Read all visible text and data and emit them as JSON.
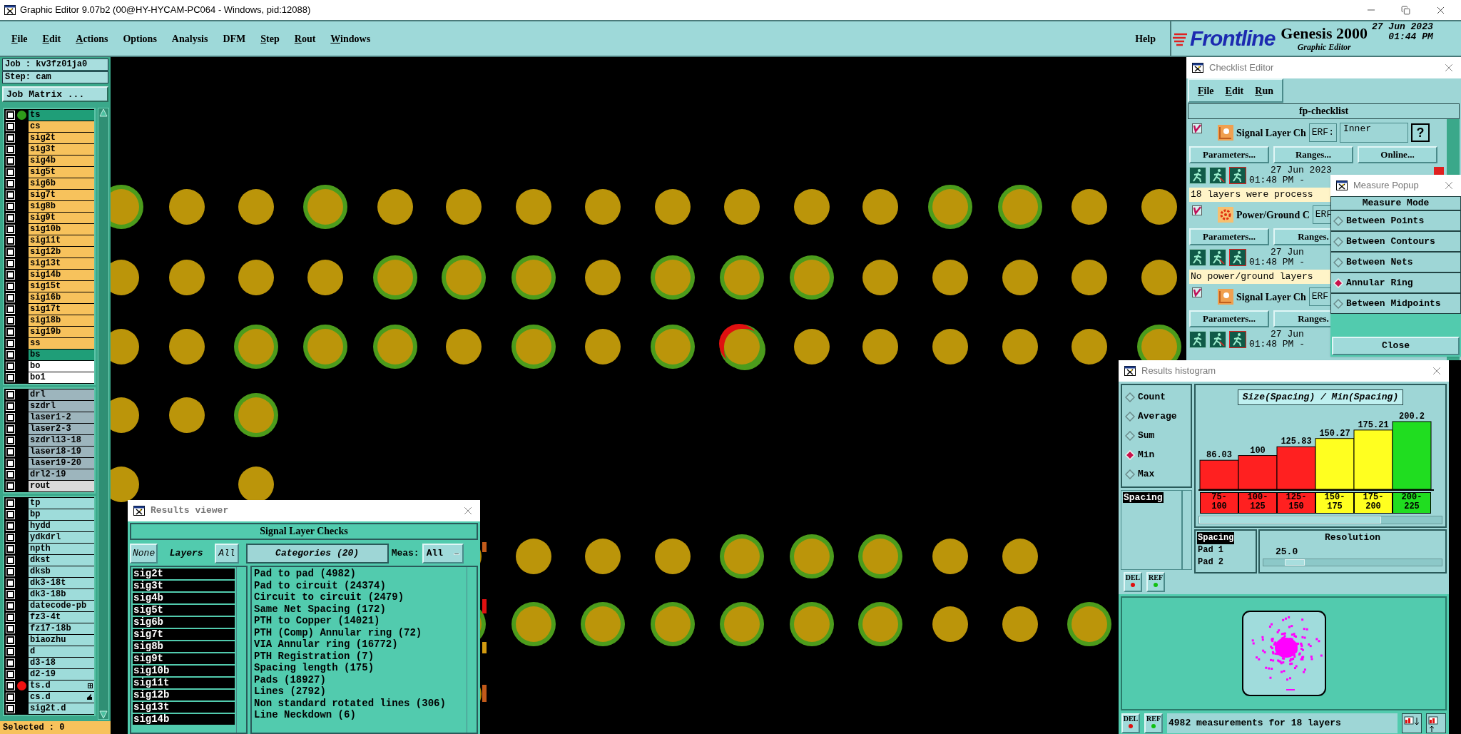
{
  "window": {
    "title": "Graphic Editor 9.07b2 (00@HY-HYCAM-PC064 - Windows, pid:12088)"
  },
  "menu": {
    "items": [
      {
        "label": "File",
        "underlined": true
      },
      {
        "label": "Edit",
        "underlined": true
      },
      {
        "label": "Actions",
        "underlined": true
      },
      {
        "label": "Options",
        "underlined": false
      },
      {
        "label": "Analysis",
        "underlined": false
      },
      {
        "label": "DFM",
        "underlined": false
      },
      {
        "label": "Step",
        "underlined": true
      },
      {
        "label": "Rout",
        "underlined": true
      },
      {
        "label": "Windows",
        "underlined": true
      }
    ],
    "help": "Help"
  },
  "logo": {
    "brand": "Frontline",
    "product": "Genesis 2000",
    "subtitle": "Graphic Editor",
    "date": "27 Jun 2023",
    "time": "01:44 PM"
  },
  "job_panel": {
    "job": "Job : kv3fz01ja0",
    "step": "Step: cam",
    "matrix_button": "Job Matrix ...",
    "selected_count": "Selected : 0",
    "groups": [
      {
        "layers": [
          {
            "name": "ts",
            "color": "#1f9e78",
            "checked": false,
            "dot": {
              "color": "#2e9a1a"
            }
          },
          {
            "name": "cs",
            "color": "#f7c25c",
            "checked": false
          },
          {
            "name": "sig2t",
            "color": "#f7c25c",
            "checked": false
          },
          {
            "name": "sig3t",
            "color": "#f7c25c",
            "checked": false
          },
          {
            "name": "sig4b",
            "color": "#f7c25c",
            "checked": false
          },
          {
            "name": "sig5t",
            "color": "#f7c25c",
            "checked": false
          },
          {
            "name": "sig6b",
            "color": "#f7c25c",
            "checked": false
          },
          {
            "name": "sig7t",
            "color": "#f7c25c",
            "checked": false
          },
          {
            "name": "sig8b",
            "color": "#f7c25c",
            "checked": false
          },
          {
            "name": "sig9t",
            "color": "#f7c25c",
            "checked": false
          },
          {
            "name": "sig10b",
            "color": "#f7c25c",
            "checked": false
          },
          {
            "name": "sig11t",
            "color": "#f7c25c",
            "checked": false
          },
          {
            "name": "sig12b",
            "color": "#f7c25c",
            "checked": false
          },
          {
            "name": "sig13t",
            "color": "#f7c25c",
            "checked": false
          },
          {
            "name": "sig14b",
            "color": "#f7c25c",
            "checked": false
          },
          {
            "name": "sig15t",
            "color": "#f7c25c",
            "checked": false
          },
          {
            "name": "sig16b",
            "color": "#f7c25c",
            "checked": false
          },
          {
            "name": "sig17t",
            "color": "#f7c25c",
            "checked": false
          },
          {
            "name": "sig18b",
            "color": "#f7c25c",
            "checked": false
          },
          {
            "name": "sig19b",
            "color": "#f7c25c",
            "checked": false
          },
          {
            "name": "ss",
            "color": "#f7c25c",
            "checked": false
          },
          {
            "name": "bs",
            "color": "#1f9e78",
            "checked": false
          },
          {
            "name": "bo",
            "color": "#ffffff",
            "checked": false
          },
          {
            "name": "bo1",
            "color": "#ffffff",
            "checked": false
          }
        ]
      },
      {
        "layers": [
          {
            "name": "drl",
            "color": "#9db5bd",
            "checked": false
          },
          {
            "name": "szdrl",
            "color": "#9db5bd",
            "checked": false
          },
          {
            "name": "laser1-2",
            "color": "#9db5bd",
            "checked": false
          },
          {
            "name": "laser2-3",
            "color": "#9db5bd",
            "checked": false
          },
          {
            "name": "szdrl13-18",
            "color": "#9db5bd",
            "checked": false
          },
          {
            "name": "laser18-19",
            "color": "#9db5bd",
            "checked": false
          },
          {
            "name": "laser19-20",
            "color": "#9db5bd",
            "checked": false
          },
          {
            "name": "drl2-19",
            "color": "#9db5bd",
            "checked": false
          },
          {
            "name": "rout",
            "color": "#d9d9d9",
            "checked": false
          }
        ]
      },
      {
        "layers": [
          {
            "name": "tp",
            "color": "#9edcda",
            "checked": false
          },
          {
            "name": "bp",
            "color": "#9edcda",
            "checked": false
          },
          {
            "name": "hydd",
            "color": "#9edcda",
            "checked": false
          },
          {
            "name": "ydkdrl",
            "color": "#9edcda",
            "checked": false
          },
          {
            "name": "npth",
            "color": "#9edcda",
            "checked": false
          },
          {
            "name": "dkst",
            "color": "#9edcda",
            "checked": false
          },
          {
            "name": "dksb",
            "color": "#9edcda",
            "checked": false
          },
          {
            "name": "dk3-18t",
            "color": "#9edcda",
            "checked": false
          },
          {
            "name": "dk3-18b",
            "color": "#9edcda",
            "checked": false
          },
          {
            "name": "datecode-pb",
            "color": "#9edcda",
            "checked": false
          },
          {
            "name": "fz3-4t",
            "color": "#9edcda",
            "checked": false
          },
          {
            "name": "fz17-18b",
            "color": "#9edcda",
            "checked": false
          },
          {
            "name": "biaozhu",
            "color": "#9edcda",
            "checked": false
          },
          {
            "name": "d",
            "color": "#9edcda",
            "checked": false
          },
          {
            "name": "d3-18",
            "color": "#9edcda",
            "checked": false
          },
          {
            "name": "d2-19",
            "color": "#9edcda",
            "checked": false
          },
          {
            "name": "ts.d",
            "color": "#9edcda",
            "checked": false,
            "dot": {
              "color": "#ee1111"
            },
            "kind": "grid"
          },
          {
            "name": "cs.d",
            "color": "#9edcda",
            "checked": false,
            "kind": "hand"
          },
          {
            "name": "sig2t.d",
            "color": "#9edcda",
            "checked": false
          }
        ]
      }
    ]
  },
  "checklist_editor": {
    "title": "Checklist Editor",
    "menu": [
      "File",
      "Edit",
      "Run"
    ],
    "name": "fp-checklist",
    "checks": [
      {
        "checked": true,
        "kind": "signal",
        "name": "Signal Layer Ch",
        "erf": "ERF:",
        "erf_value": "Inner",
        "help": "?",
        "buttons": [
          "Parameters...",
          "Ranges...",
          "Online..."
        ],
        "date": "27 Jun 2023",
        "time": "01:48 PM -",
        "message": "18 layers were process"
      },
      {
        "checked": true,
        "kind": "power",
        "name": "Power/Ground C",
        "erf": "ERF",
        "buttons": [
          "Parameters...",
          "Ranges."
        ],
        "date": "27 Jun",
        "time": "01:48 PM -",
        "message": "No power/ground layers"
      },
      {
        "checked": true,
        "kind": "signal",
        "name": "Signal Layer Ch",
        "erf": "ERF",
        "buttons": [
          "Parameters...",
          "Ranges."
        ],
        "date": "27 Jun",
        "time": "01:48 PM -"
      }
    ]
  },
  "measure_popup": {
    "title": "Measure Popup",
    "header": "Measure Mode",
    "options": [
      {
        "label": "Between Points",
        "selected": false
      },
      {
        "label": "Between Contours",
        "selected": false
      },
      {
        "label": "Between Nets",
        "selected": false
      },
      {
        "label": "Annular Ring",
        "selected": true
      },
      {
        "label": "Between Midpoints",
        "selected": false
      }
    ],
    "close": "Close"
  },
  "results_histogram": {
    "title": "Results histogram",
    "modes": [
      {
        "label": "Count",
        "selected": false
      },
      {
        "label": "Average",
        "selected": false
      },
      {
        "label": "Sum",
        "selected": false
      },
      {
        "label": "Min",
        "selected": true
      },
      {
        "label": "Max",
        "selected": false
      }
    ],
    "measures": [
      {
        "label": "Spacing",
        "selected": true
      }
    ],
    "del": "DEL",
    "ref": "REF",
    "chart_data": {
      "type": "bar",
      "title": "Size(Spacing) / Min(Spacing)",
      "categories": [
        "75-100",
        "100-125",
        "125-150",
        "150-175",
        "175-200",
        "200-225"
      ],
      "values": [
        86.03,
        100,
        125.83,
        150.27,
        175.21,
        200.2
      ],
      "data_labels": true
    },
    "bins": [
      {
        "color": "#ff2020"
      },
      {
        "color": "#ff2020"
      },
      {
        "color": "#ff2020"
      },
      {
        "color": "#ffff20"
      },
      {
        "color": "#ffff20"
      },
      {
        "color": "#20dd20"
      }
    ],
    "fields": [
      {
        "label": "Spacing",
        "selected": true
      },
      {
        "label": "Pad 1",
        "selected": false
      },
      {
        "label": "Pad 2",
        "selected": false
      }
    ],
    "resolution": {
      "label": "Resolution",
      "value": "25.0",
      "level": 0.12
    },
    "footer_del": "DEL",
    "footer_ref": "REF",
    "status": "4982 measurements for 18 layers"
  },
  "results_viewer": {
    "title": "Results viewer",
    "header": "Signal Layer Checks",
    "none": "None",
    "layers_label": "Layers",
    "all": "All",
    "categories_label": "Categories (20)",
    "meas_label": "Meas:",
    "meas_value": "All",
    "layers": [
      {
        "name": "sig2t",
        "selected": true
      },
      {
        "name": "sig3t",
        "selected": true
      },
      {
        "name": "sig4b",
        "selected": true
      },
      {
        "name": "sig5t",
        "selected": true
      },
      {
        "name": "sig6b",
        "selected": true
      },
      {
        "name": "sig7t",
        "selected": true
      },
      {
        "name": "sig8b",
        "selected": true
      },
      {
        "name": "sig9t",
        "selected": true
      },
      {
        "name": "sig10b",
        "selected": true
      },
      {
        "name": "sig11t",
        "selected": true
      },
      {
        "name": "sig12b",
        "selected": true
      },
      {
        "name": "sig13t",
        "selected": true
      },
      {
        "name": "sig14b",
        "selected": true
      }
    ],
    "categories": [
      "Pad to pad (4982)",
      "Pad to circuit (24374)",
      "Circuit to circuit (2479)",
      "Same Net Spacing (172)",
      "PTH to Copper (14021)",
      "PTH (Comp) Annular ring (72)",
      "VIA Annular ring (16772)",
      "PTH Registration (7)",
      "Spacing length (175)",
      "Pads (18927)",
      "Lines (2792)",
      "Non standard rotated lines (306)",
      "Line Neckdown (6)"
    ]
  }
}
